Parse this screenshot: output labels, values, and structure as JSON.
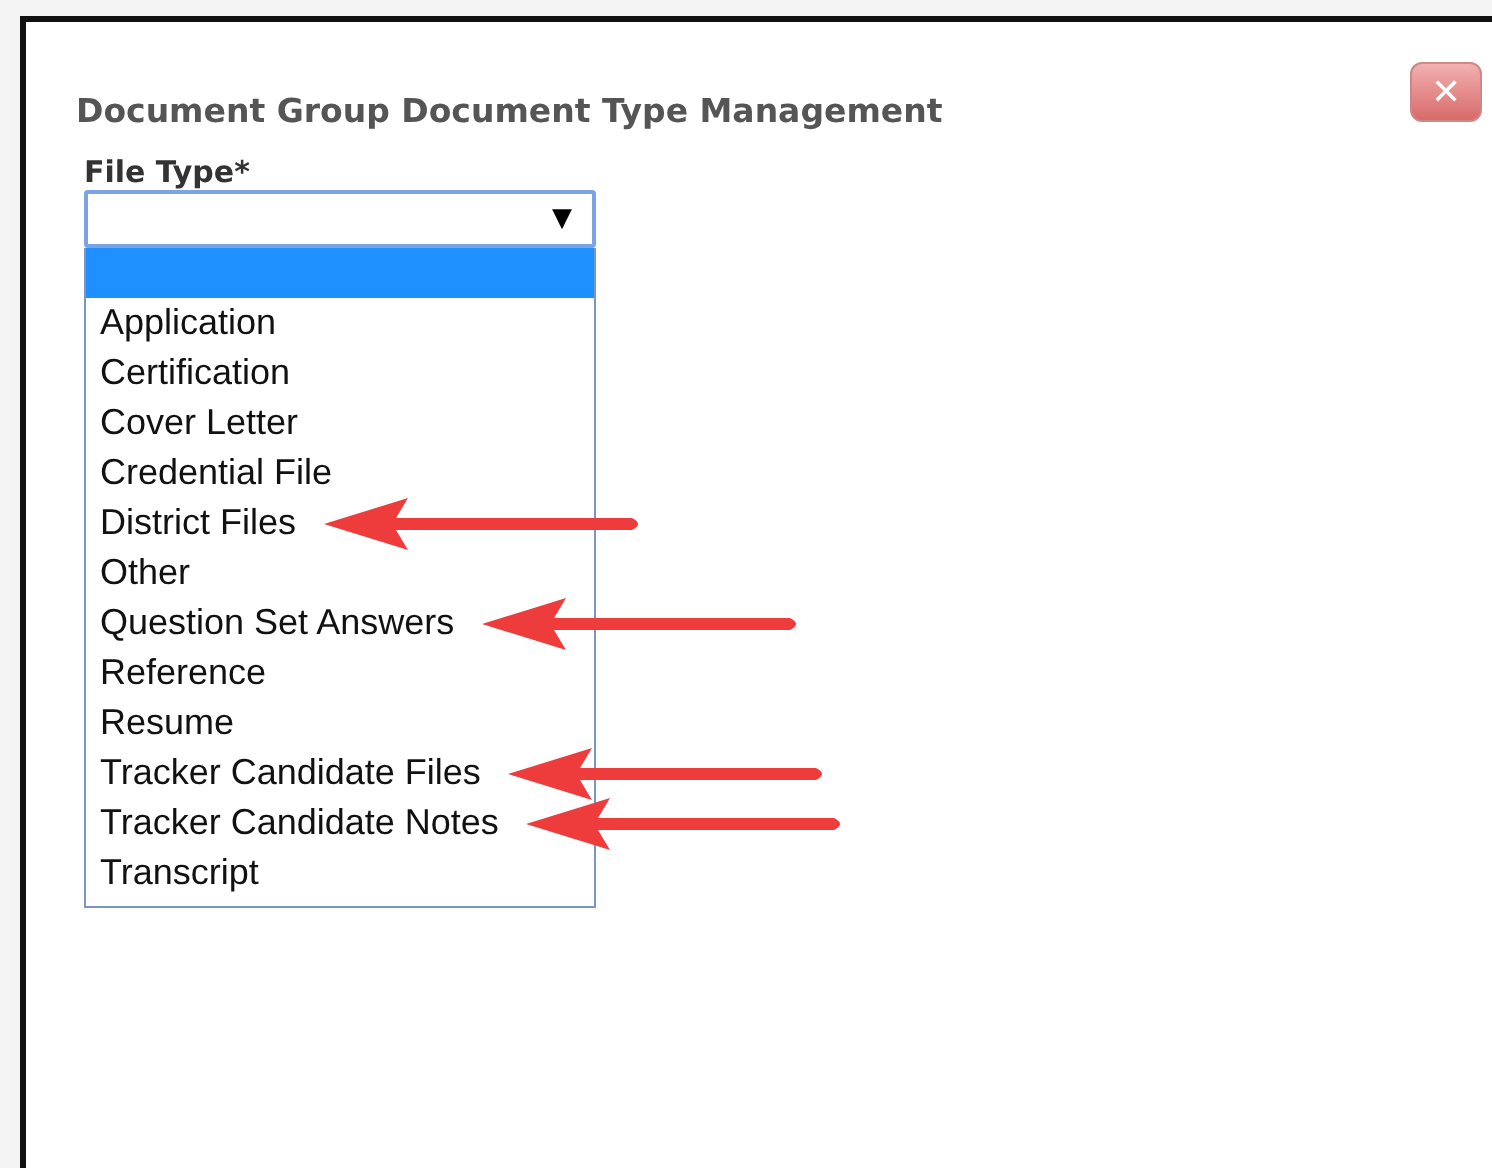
{
  "dialog": {
    "title": "Document Group Document Type Management",
    "close_button": {
      "label": "✕"
    }
  },
  "field": {
    "label": "File Type*",
    "arrow": "▼"
  },
  "options": [
    {
      "selected": true,
      "arrow": false
    },
    {
      "label": "Application",
      "selected": false,
      "arrow": false
    },
    {
      "label": "Certification",
      "selected": false,
      "arrow": false
    },
    {
      "label": "Cover Letter",
      "selected": false,
      "arrow": false
    },
    {
      "label": "Credential File",
      "selected": false,
      "arrow": false
    },
    {
      "label": "District Files",
      "selected": false,
      "arrow": true
    },
    {
      "label": "Other",
      "selected": false,
      "arrow": false
    },
    {
      "label": "Question Set Answers",
      "selected": false,
      "arrow": true
    },
    {
      "label": "Reference",
      "selected": false,
      "arrow": false
    },
    {
      "label": "Resume",
      "selected": false,
      "arrow": false
    },
    {
      "label": "Tracker Candidate Files",
      "selected": false,
      "arrow": true
    },
    {
      "label": "Tracker Candidate Notes",
      "selected": false,
      "arrow": true
    },
    {
      "label": "Transcript",
      "selected": false,
      "arrow": false
    }
  ]
}
